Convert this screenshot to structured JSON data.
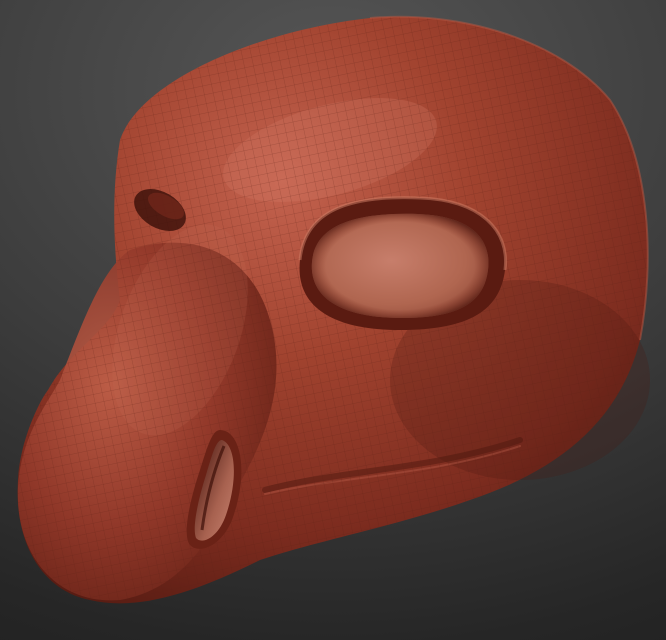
{
  "viewport": {
    "kind": "3d-sculpt-view",
    "subject": "sculpted-head-mesh",
    "colors": {
      "background_top": "#565656",
      "background_bottom": "#1e1e1e",
      "clay_base": "#8c3526",
      "clay_highlight": "#c4634f",
      "clay_shadow": "#4a160e",
      "wireframe": "#5b1f15"
    }
  }
}
